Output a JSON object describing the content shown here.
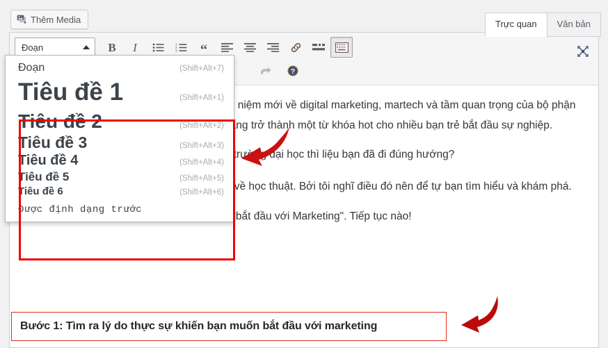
{
  "window": {
    "app": "WordPress Classic Editor"
  },
  "media": {
    "label": "Thêm Media",
    "icon": "add-media-icon"
  },
  "tabs": [
    {
      "label": "Trực quan",
      "active": true,
      "name": "tab-visual"
    },
    {
      "label": "Văn bản",
      "active": false,
      "name": "tab-text"
    }
  ],
  "toolbar": {
    "format_select": {
      "value": "Đoạn",
      "caret": "caret-up-icon"
    },
    "buttons": [
      {
        "name": "bold-button",
        "glyph": "B",
        "title": "Đậm"
      },
      {
        "name": "italic-button",
        "glyph": "I",
        "title": "Nghiêng"
      },
      {
        "name": "bulleted-list-button",
        "glyph": "",
        "title": "Danh sách không thứ tự"
      },
      {
        "name": "numbered-list-button",
        "glyph": "",
        "title": "Danh sách có thứ tự"
      },
      {
        "name": "blockquote-button",
        "glyph": "“",
        "title": "Trích dẫn"
      },
      {
        "name": "align-left-button",
        "glyph": "",
        "title": "Canh trái"
      },
      {
        "name": "align-center-button",
        "glyph": "",
        "title": "Canh giữa"
      },
      {
        "name": "align-right-button",
        "glyph": "",
        "title": "Canh phải"
      },
      {
        "name": "insert-link-button",
        "glyph": "",
        "title": "Chèn liên kết"
      },
      {
        "name": "read-more-button",
        "glyph": "",
        "title": "Chèn thẻ đọc thêm"
      },
      {
        "name": "toggle-toolbar-button",
        "glyph": "",
        "title": "Thanh công cụ mở rộng"
      }
    ],
    "redo_label": "Làm lại",
    "help_label": "Trợ giúp",
    "fullscreen_label": "Chế độ viết không phân tâm"
  },
  "dropdown": {
    "items": [
      {
        "label": "Đoạn",
        "accel": "(Shift+Alt+7)",
        "level": "p",
        "name": "format-option-paragraph"
      },
      {
        "label": "Tiêu đề 1",
        "accel": "(Shift+Alt+1)",
        "level": "1",
        "name": "format-option-heading-1"
      },
      {
        "label": "Tiêu đề 2",
        "accel": "(Shift+Alt+2)",
        "level": "2",
        "name": "format-option-heading-2"
      },
      {
        "label": "Tiêu đề 3",
        "accel": "(Shift+Alt+3)",
        "level": "3",
        "name": "format-option-heading-3"
      },
      {
        "label": "Tiêu đề 4",
        "accel": "(Shift+Alt+4)",
        "level": "4",
        "name": "format-option-heading-4"
      },
      {
        "label": "Tiêu đề 5",
        "accel": "(Shift+Alt+5)",
        "level": "5",
        "name": "format-option-heading-5"
      },
      {
        "label": "Tiêu đề 6",
        "accel": "(Shift+Alt+6)",
        "level": "6",
        "name": "format-option-heading-6"
      },
      {
        "label": "Được định dạng trước",
        "accel": "",
        "level": "pre",
        "name": "format-option-preformatted"
      }
    ]
  },
  "content": {
    "paragraphs": [
      "Sau khi đọc xong bài viết giới thiệu các khái niệm mới về digital marketing, martech và tầm quan trọng của bộ phận marketing trong doanh nghiệp. Marketing càng trở thành một từ khóa hot cho nhiều bạn trẻ bắt đầu sự nghiệp.",
      "Nếu bạn đang theo học ngành marketing ở trường đại học thì liệu bạn đã đi đúng hướng?",
      "Tôi sẽ không nói nhiều về những khái niệm về học thuật. Bởi tôi nghĩ điều đó nên để tự bạn tìm hiểu và khám phá.",
      "Trong bài viết này tôi sẽ chia sẻ \"5 bước để bắt đầu với Marketing\". Tiếp tục nào!"
    ]
  },
  "heading_block": {
    "text": "Bước 1: Tìm ra lý do thực sự khiến bạn muốn bắt đầu với marketing"
  },
  "annotations": {
    "highlight_color": "#ef0000",
    "arrow_color": "#cc1111",
    "arrows": [
      {
        "name": "annotation-arrow-to-dropdown"
      },
      {
        "name": "annotation-arrow-to-heading"
      }
    ]
  }
}
